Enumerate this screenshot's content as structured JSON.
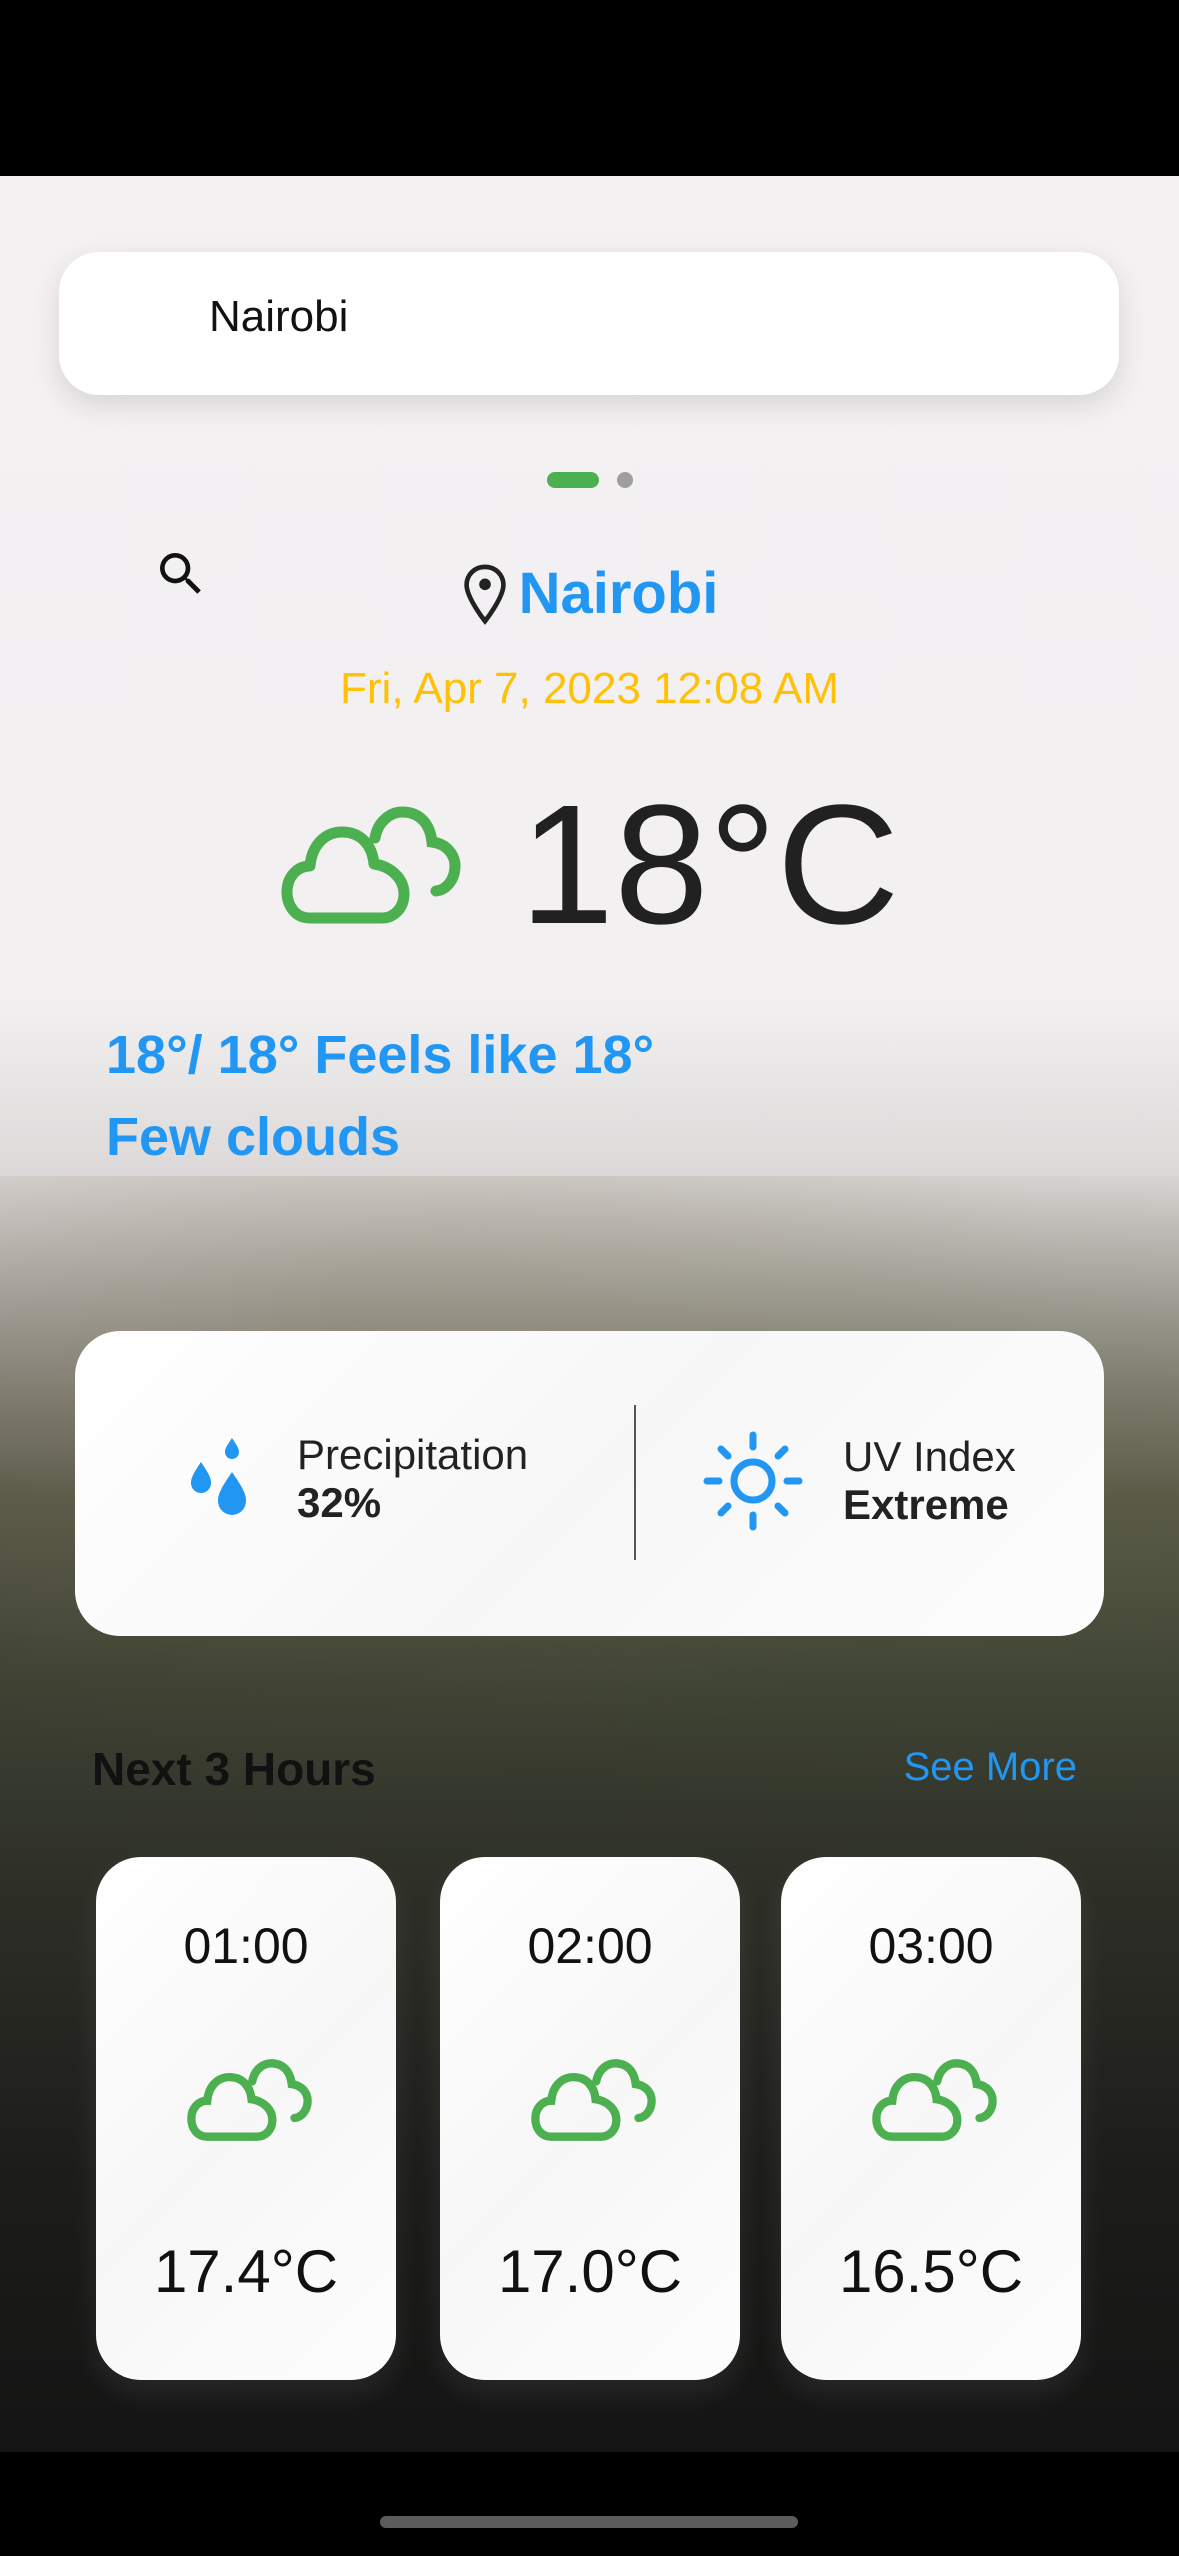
{
  "search": {
    "value": "Nairobi",
    "icon": "search-icon"
  },
  "pager": {
    "pages": 2,
    "active": 1,
    "active_color": "#4CAF50"
  },
  "location": {
    "city": "Nairobi",
    "datetime": "Fri, Apr 7, 2023 12:08 AM"
  },
  "current": {
    "temperature": "18°C",
    "icon": "cloud-icon",
    "feels": "18°/ 18° Feels like 18°",
    "description": "Few clouds"
  },
  "stats": {
    "precipitation": {
      "label": "Precipitation",
      "value": "32%",
      "icon": "water-drops-icon"
    },
    "uv": {
      "label": "UV Index",
      "value": "Extreme",
      "icon": "sun-icon"
    }
  },
  "forecast": {
    "title": "Next 3 Hours",
    "see_more": "See More",
    "hours": [
      {
        "time": "01:00",
        "temp": "17.4°C",
        "icon": "cloud-icon"
      },
      {
        "time": "02:00",
        "temp": "17.0°C",
        "icon": "cloud-icon"
      },
      {
        "time": "03:00",
        "temp": "16.5°C",
        "icon": "cloud-icon"
      }
    ]
  },
  "colors": {
    "accent": "#2196F3",
    "date": "#FFC107",
    "icon_green": "#4CAF50"
  }
}
